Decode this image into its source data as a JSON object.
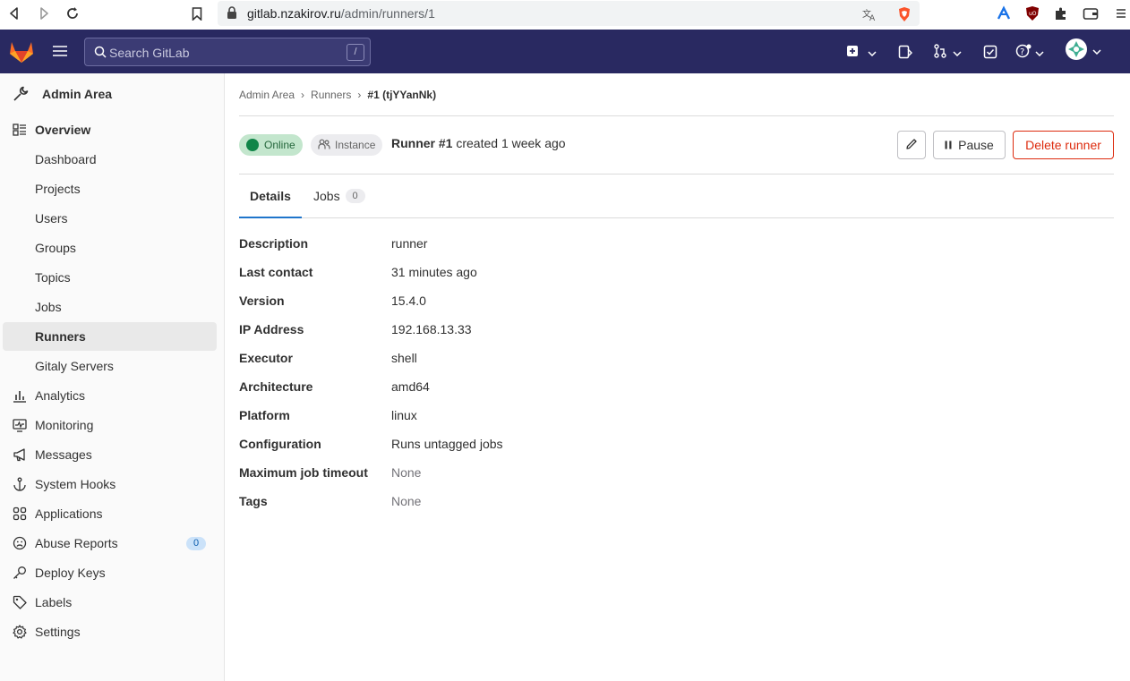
{
  "browser": {
    "url_host": "gitlab.nzakirov.ru",
    "url_path": "/admin/runners/1"
  },
  "header": {
    "search_placeholder": "Search GitLab",
    "search_shortcut": "/"
  },
  "sidebar": {
    "title": "Admin Area",
    "items": [
      {
        "label": "Overview",
        "icon": "overview-icon",
        "bold": true
      },
      {
        "label": "Dashboard"
      },
      {
        "label": "Projects"
      },
      {
        "label": "Users"
      },
      {
        "label": "Groups"
      },
      {
        "label": "Topics"
      },
      {
        "label": "Jobs"
      },
      {
        "label": "Runners",
        "active": true
      },
      {
        "label": "Gitaly Servers"
      },
      {
        "label": "Analytics",
        "icon": "analytics-icon"
      },
      {
        "label": "Monitoring",
        "icon": "monitor-icon"
      },
      {
        "label": "Messages",
        "icon": "megaphone-icon"
      },
      {
        "label": "System Hooks",
        "icon": "anchor-icon"
      },
      {
        "label": "Applications",
        "icon": "applications-icon"
      },
      {
        "label": "Abuse Reports",
        "icon": "abuse-icon",
        "badge": "0"
      },
      {
        "label": "Deploy Keys",
        "icon": "key-icon"
      },
      {
        "label": "Labels",
        "icon": "label-icon"
      },
      {
        "label": "Settings",
        "icon": "settings-icon"
      }
    ]
  },
  "breadcrumb": [
    "Admin Area",
    "Runners",
    "#1 (tjYYanNk)"
  ],
  "runner": {
    "status": "Online",
    "type": "Instance",
    "name": "Runner #1",
    "created": "created 1 week ago"
  },
  "actions": {
    "pause": "Pause",
    "delete": "Delete runner"
  },
  "tabs": {
    "details": "Details",
    "jobs": "Jobs",
    "jobs_count": "0"
  },
  "details": [
    {
      "key": "Description",
      "value": "runner"
    },
    {
      "key": "Last contact",
      "value": "31 minutes ago"
    },
    {
      "key": "Version",
      "value": "15.4.0"
    },
    {
      "key": "IP Address",
      "value": "192.168.13.33"
    },
    {
      "key": "Executor",
      "value": "shell"
    },
    {
      "key": "Architecture",
      "value": "amd64"
    },
    {
      "key": "Platform",
      "value": "linux"
    },
    {
      "key": "Configuration",
      "value": "Runs untagged jobs"
    },
    {
      "key": "Maximum job timeout",
      "value": "None",
      "muted": true
    },
    {
      "key": "Tags",
      "value": "None",
      "muted": true
    }
  ],
  "colors": {
    "header_bg": "#292961",
    "online": "#108548",
    "danger": "#dd2b0e"
  }
}
